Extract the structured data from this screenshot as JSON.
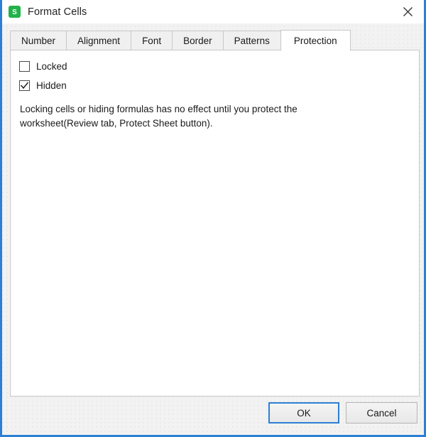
{
  "window": {
    "title": "Format Cells",
    "app_icon": "spreadsheet-s-icon",
    "close_icon": "close-icon",
    "accent_color": "#2b7fd4",
    "icon_color": "#21b24b"
  },
  "tabs": [
    {
      "label": "Number",
      "active": false
    },
    {
      "label": "Alignment",
      "active": false
    },
    {
      "label": "Font",
      "active": false
    },
    {
      "label": "Border",
      "active": false
    },
    {
      "label": "Patterns",
      "active": false
    },
    {
      "label": "Protection",
      "active": true
    }
  ],
  "protection_panel": {
    "options": [
      {
        "label": "Locked",
        "checked": false
      },
      {
        "label": "Hidden",
        "checked": true
      }
    ],
    "note": "Locking cells or hiding formulas has no effect until you protect the worksheet(Review tab, Protect Sheet button)."
  },
  "footer": {
    "ok_label": "OK",
    "cancel_label": "Cancel"
  }
}
